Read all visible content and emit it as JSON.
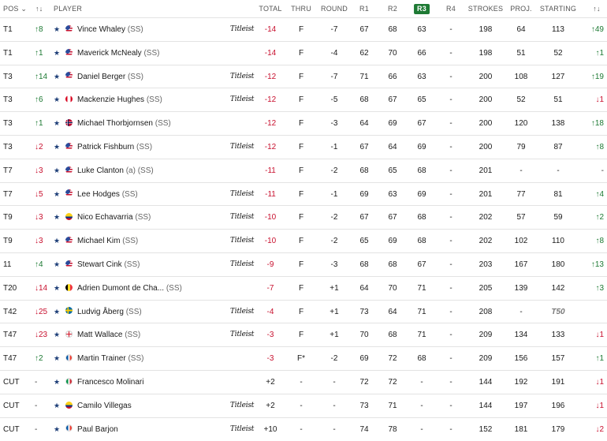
{
  "columns": {
    "pos": "POS",
    "pos_move": "↑↓",
    "player": "PLAYER",
    "total": "TOTAL",
    "thru": "THRU",
    "round": "ROUND",
    "r1": "R1",
    "r2": "R2",
    "r3": "R3",
    "r4": "R4",
    "strokes": "STROKES",
    "proj": "PROJ.",
    "starting": "STARTING",
    "start_move": "↑↓"
  },
  "sponsor_logo": "Titleist",
  "rows": [
    {
      "pos": "T1",
      "move": "↑8",
      "move_dir": "up",
      "flag": "USA",
      "name": "Vince Whaley",
      "ss": "(SS)",
      "logo": true,
      "total": "-14",
      "total_red": true,
      "thru": "F",
      "round": "-7",
      "r1": "67",
      "r2": "68",
      "r3": "63",
      "r4": "-",
      "strokes": "198",
      "proj": "64",
      "starting": "113",
      "smove": "↑49",
      "smove_dir": "up"
    },
    {
      "pos": "T1",
      "move": "↑1",
      "move_dir": "up",
      "flag": "USA",
      "name": "Maverick McNealy",
      "ss": "(SS)",
      "logo": false,
      "total": "-14",
      "total_red": true,
      "thru": "F",
      "round": "-4",
      "r1": "62",
      "r2": "70",
      "r3": "66",
      "r4": "-",
      "strokes": "198",
      "proj": "51",
      "starting": "52",
      "smove": "↑1",
      "smove_dir": "up"
    },
    {
      "pos": "T3",
      "move": "↑14",
      "move_dir": "up",
      "flag": "USA",
      "name": "Daniel Berger",
      "ss": "(SS)",
      "logo": true,
      "total": "-12",
      "total_red": true,
      "thru": "F",
      "round": "-7",
      "r1": "71",
      "r2": "66",
      "r3": "63",
      "r4": "-",
      "strokes": "200",
      "proj": "108",
      "starting": "127",
      "smove": "↑19",
      "smove_dir": "up"
    },
    {
      "pos": "T3",
      "move": "↑6",
      "move_dir": "up",
      "flag": "CAN",
      "name": "Mackenzie Hughes",
      "ss": "(SS)",
      "logo": true,
      "total": "-12",
      "total_red": true,
      "thru": "F",
      "round": "-5",
      "r1": "68",
      "r2": "67",
      "r3": "65",
      "r4": "-",
      "strokes": "200",
      "proj": "52",
      "starting": "51",
      "smove": "↓1",
      "smove_dir": "down"
    },
    {
      "pos": "T3",
      "move": "↑1",
      "move_dir": "up",
      "flag": "NOR",
      "name": "Michael Thorbjornsen",
      "ss": "(SS)",
      "logo": false,
      "total": "-12",
      "total_red": true,
      "thru": "F",
      "round": "-3",
      "r1": "64",
      "r2": "69",
      "r3": "67",
      "r4": "-",
      "strokes": "200",
      "proj": "120",
      "starting": "138",
      "smove": "↑18",
      "smove_dir": "up"
    },
    {
      "pos": "T3",
      "move": "↓2",
      "move_dir": "down",
      "flag": "USA",
      "name": "Patrick Fishburn",
      "ss": "(SS)",
      "logo": true,
      "total": "-12",
      "total_red": true,
      "thru": "F",
      "round": "-1",
      "r1": "67",
      "r2": "64",
      "r3": "69",
      "r4": "-",
      "strokes": "200",
      "proj": "79",
      "starting": "87",
      "smove": "↑8",
      "smove_dir": "up"
    },
    {
      "pos": "T7",
      "move": "↓3",
      "move_dir": "down",
      "flag": "USA",
      "name": "Luke Clanton",
      "ss": "(a) (SS)",
      "logo": false,
      "total": "-11",
      "total_red": true,
      "thru": "F",
      "round": "-2",
      "r1": "68",
      "r2": "65",
      "r3": "68",
      "r4": "-",
      "strokes": "201",
      "proj": "-",
      "starting": "-",
      "smove": "-",
      "smove_dir": "neutral"
    },
    {
      "pos": "T7",
      "move": "↓5",
      "move_dir": "down",
      "flag": "USA",
      "name": "Lee Hodges",
      "ss": "(SS)",
      "logo": true,
      "total": "-11",
      "total_red": true,
      "thru": "F",
      "round": "-1",
      "r1": "69",
      "r2": "63",
      "r3": "69",
      "r4": "-",
      "strokes": "201",
      "proj": "77",
      "starting": "81",
      "smove": "↑4",
      "smove_dir": "up"
    },
    {
      "pos": "T9",
      "move": "↓3",
      "move_dir": "down",
      "flag": "COL",
      "name": "Nico Echavarria",
      "ss": "(SS)",
      "logo": true,
      "total": "-10",
      "total_red": true,
      "thru": "F",
      "round": "-2",
      "r1": "67",
      "r2": "67",
      "r3": "68",
      "r4": "-",
      "strokes": "202",
      "proj": "57",
      "starting": "59",
      "smove": "↑2",
      "smove_dir": "up"
    },
    {
      "pos": "T9",
      "move": "↓3",
      "move_dir": "down",
      "flag": "USA",
      "name": "Michael Kim",
      "ss": "(SS)",
      "logo": true,
      "total": "-10",
      "total_red": true,
      "thru": "F",
      "round": "-2",
      "r1": "65",
      "r2": "69",
      "r3": "68",
      "r4": "-",
      "strokes": "202",
      "proj": "102",
      "starting": "110",
      "smove": "↑8",
      "smove_dir": "up"
    },
    {
      "pos": "11",
      "move": "↑4",
      "move_dir": "up",
      "flag": "USA",
      "name": "Stewart Cink",
      "ss": "(SS)",
      "logo": true,
      "total": "-9",
      "total_red": true,
      "thru": "F",
      "round": "-3",
      "r1": "68",
      "r2": "68",
      "r3": "67",
      "r4": "-",
      "strokes": "203",
      "proj": "167",
      "starting": "180",
      "smove": "↑13",
      "smove_dir": "up"
    },
    {
      "pos": "T20",
      "move": "↓14",
      "move_dir": "down",
      "flag": "BEL",
      "name": "Adrien Dumont de Cha...",
      "ss": "(SS)",
      "logo": false,
      "total": "-7",
      "total_red": true,
      "thru": "F",
      "round": "+1",
      "r1": "64",
      "r2": "70",
      "r3": "71",
      "r4": "-",
      "strokes": "205",
      "proj": "139",
      "starting": "142",
      "smove": "↑3",
      "smove_dir": "up"
    },
    {
      "pos": "T42",
      "move": "↓25",
      "move_dir": "down",
      "flag": "SWE",
      "name": "Ludvig Åberg",
      "ss": "(SS)",
      "logo": true,
      "total": "-4",
      "total_red": true,
      "thru": "F",
      "round": "+1",
      "r1": "73",
      "r2": "64",
      "r3": "71",
      "r4": "-",
      "strokes": "208",
      "proj": "-",
      "starting": "T50",
      "smove": "",
      "smove_dir": "neutral"
    },
    {
      "pos": "T47",
      "move": "↓23",
      "move_dir": "down",
      "flag": "ENG",
      "name": "Matt Wallace",
      "ss": "(SS)",
      "logo": true,
      "total": "-3",
      "total_red": true,
      "thru": "F",
      "round": "+1",
      "r1": "70",
      "r2": "68",
      "r3": "71",
      "r4": "-",
      "strokes": "209",
      "proj": "134",
      "starting": "133",
      "smove": "↓1",
      "smove_dir": "down"
    },
    {
      "pos": "T47",
      "move": "↑2",
      "move_dir": "up",
      "flag": "FRA",
      "name": "Martin Trainer",
      "ss": "(SS)",
      "logo": false,
      "total": "-3",
      "total_red": true,
      "thru": "F*",
      "round": "-2",
      "r1": "69",
      "r2": "72",
      "r3": "68",
      "r4": "-",
      "strokes": "209",
      "proj": "156",
      "starting": "157",
      "smove": "↑1",
      "smove_dir": "up"
    },
    {
      "pos": "CUT",
      "move": "-",
      "move_dir": "neutral",
      "flag": "ITA",
      "name": "Francesco Molinari",
      "ss": "",
      "logo": false,
      "total": "+2",
      "total_red": false,
      "thru": "-",
      "round": "-",
      "r1": "72",
      "r2": "72",
      "r3": "-",
      "r4": "-",
      "strokes": "144",
      "proj": "192",
      "starting": "191",
      "smove": "↓1",
      "smove_dir": "down"
    },
    {
      "pos": "CUT",
      "move": "-",
      "move_dir": "neutral",
      "flag": "COL",
      "name": "Camilo Villegas",
      "ss": "",
      "logo": true,
      "total": "+2",
      "total_red": false,
      "thru": "-",
      "round": "-",
      "r1": "73",
      "r2": "71",
      "r3": "-",
      "r4": "-",
      "strokes": "144",
      "proj": "197",
      "starting": "196",
      "smove": "↓1",
      "smove_dir": "down"
    },
    {
      "pos": "CUT",
      "move": "-",
      "move_dir": "neutral",
      "flag": "FRA",
      "name": "Paul Barjon",
      "ss": "",
      "logo": true,
      "total": "+10",
      "total_red": false,
      "thru": "-",
      "round": "-",
      "r1": "74",
      "r2": "78",
      "r3": "-",
      "r4": "-",
      "strokes": "152",
      "proj": "181",
      "starting": "179",
      "smove": "↓2",
      "smove_dir": "down"
    }
  ]
}
